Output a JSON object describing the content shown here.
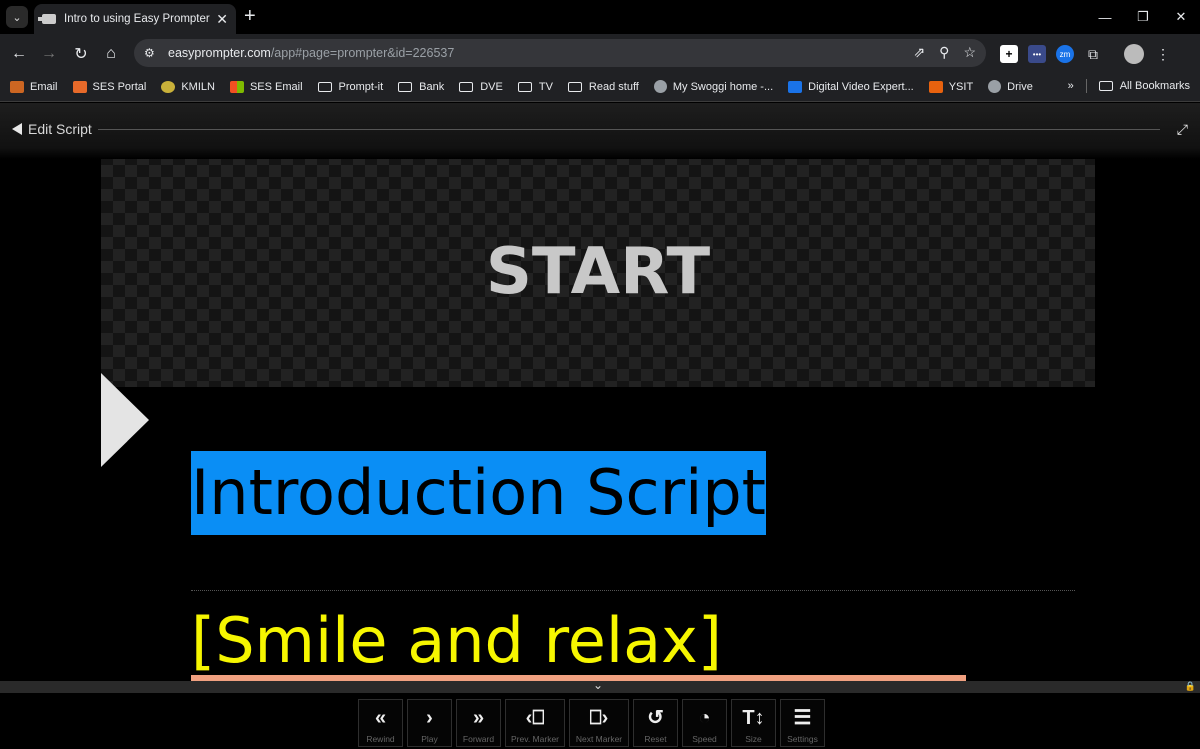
{
  "browser": {
    "tab_title": "Intro to using Easy Prompter :: E",
    "url_domain": "easyprompter.com",
    "url_path": "/app#page=prompter&id=226537",
    "bookmarks": [
      {
        "label": "Email",
        "icon": "email-icon"
      },
      {
        "label": "SES Portal",
        "icon": "ses-portal-icon"
      },
      {
        "label": "KMILN",
        "icon": "kmiln-icon"
      },
      {
        "label": "SES Email",
        "icon": "microsoft-icon"
      },
      {
        "label": "Prompt-it",
        "icon": "folder-icon"
      },
      {
        "label": "Bank",
        "icon": "folder-icon"
      },
      {
        "label": "DVE",
        "icon": "folder-icon"
      },
      {
        "label": "TV",
        "icon": "folder-icon"
      },
      {
        "label": "Read stuff",
        "icon": "folder-icon"
      },
      {
        "label": "My Swoggi home -...",
        "icon": "globe-icon"
      },
      {
        "label": "Digital Video Expert...",
        "icon": "calendar-icon"
      },
      {
        "label": "YSIT",
        "icon": "ysit-icon"
      },
      {
        "label": "Drive",
        "icon": "globe-icon"
      }
    ],
    "all_bookmarks": "All Bookmarks",
    "more_bookmarks": "»"
  },
  "app": {
    "back_label": "Edit Script",
    "start_label": "START",
    "script_title": "Introduction Script",
    "cue_text": "[Smile and relax]"
  },
  "controls": [
    {
      "label": "Rewind",
      "icon": "rewind-icon",
      "glyph": "«"
    },
    {
      "label": "Play",
      "icon": "play-icon",
      "glyph": "›"
    },
    {
      "label": "Forward",
      "icon": "forward-icon",
      "glyph": "»"
    },
    {
      "label": "Prev. Marker",
      "icon": "prev-marker-icon",
      "glyph": "‹⎕"
    },
    {
      "label": "Next Marker",
      "icon": "next-marker-icon",
      "glyph": "⎕›"
    },
    {
      "label": "Reset",
      "icon": "reset-icon",
      "glyph": "↺"
    },
    {
      "label": "Speed",
      "icon": "speed-icon",
      "glyph": "◔"
    },
    {
      "label": "Size",
      "icon": "size-icon",
      "glyph": "T↕"
    },
    {
      "label": "Settings",
      "icon": "settings-icon",
      "glyph": "☰"
    }
  ],
  "colors": {
    "title_highlight": "#0a8ef5",
    "cue_text": "#f6f600",
    "underline": "#f0a080"
  }
}
